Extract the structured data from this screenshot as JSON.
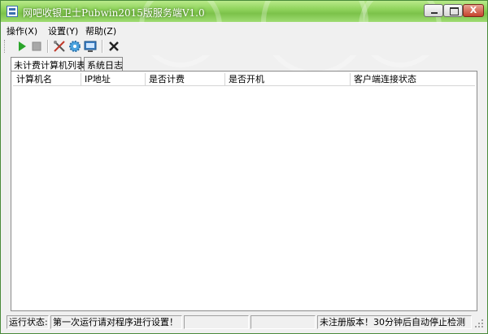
{
  "window": {
    "title": "网吧收银卫士Pubwin2015版服务端V1.0"
  },
  "title_buttons": {
    "minimize": "minimize",
    "maximize": "maximize",
    "close": "X"
  },
  "menu": {
    "items": [
      "操作(X)",
      "设置(Y)",
      "帮助(Z)"
    ]
  },
  "toolbar": {
    "icons": [
      "play-icon",
      "stop-icon",
      "tools-icon",
      "settings-gear-icon",
      "computer-icon",
      "close-x-icon"
    ]
  },
  "tabs": [
    "未计费计算机列表",
    "系统日志"
  ],
  "table": {
    "columns": [
      "计算机名",
      "IP地址",
      "是否计费",
      "是否开机",
      "客户端连接状态"
    ],
    "rows": []
  },
  "status": {
    "label": "运行状态:",
    "message": "第一次运行请对程序进行设置！",
    "register": "未注册版本！30分钟后自动停止检测"
  },
  "colors": {
    "titlebar": "#8fd35c",
    "border": "#4a8a3a"
  }
}
